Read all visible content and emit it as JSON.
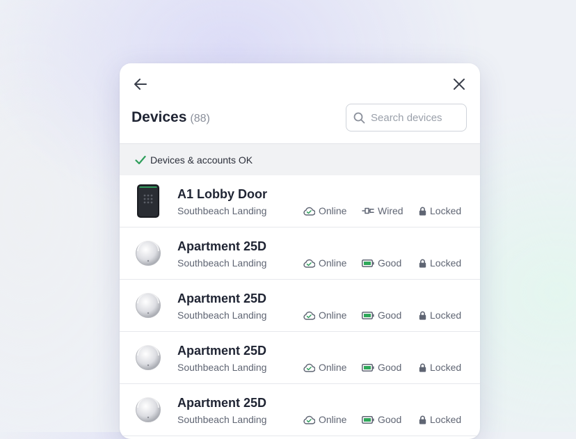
{
  "header": {
    "title": "Devices",
    "count": "(88)",
    "search_placeholder": "Search devices"
  },
  "status": {
    "text": "Devices & accounts OK",
    "color": "#2e9e5b"
  },
  "colors": {
    "battery_good": "#2fa85a",
    "text_primary": "#1f2433",
    "text_secondary": "#5f6573"
  },
  "devices": [
    {
      "name": "A1 Lobby Door",
      "location": "Southbeach Landing",
      "type": "keypad",
      "connection": "Online",
      "power": "Wired",
      "power_icon": "plug-icon",
      "lock": "Locked"
    },
    {
      "name": "Apartment 25D",
      "location": "Southbeach Landing",
      "type": "smart-lock",
      "connection": "Online",
      "power": "Good",
      "power_icon": "battery-icon",
      "lock": "Locked"
    },
    {
      "name": "Apartment 25D",
      "location": "Southbeach Landing",
      "type": "smart-lock",
      "connection": "Online",
      "power": "Good",
      "power_icon": "battery-icon",
      "lock": "Locked"
    },
    {
      "name": "Apartment 25D",
      "location": "Southbeach Landing",
      "type": "smart-lock",
      "connection": "Online",
      "power": "Good",
      "power_icon": "battery-icon",
      "lock": "Locked"
    },
    {
      "name": "Apartment 25D",
      "location": "Southbeach Landing",
      "type": "smart-lock",
      "connection": "Online",
      "power": "Good",
      "power_icon": "battery-icon",
      "lock": "Locked"
    }
  ]
}
